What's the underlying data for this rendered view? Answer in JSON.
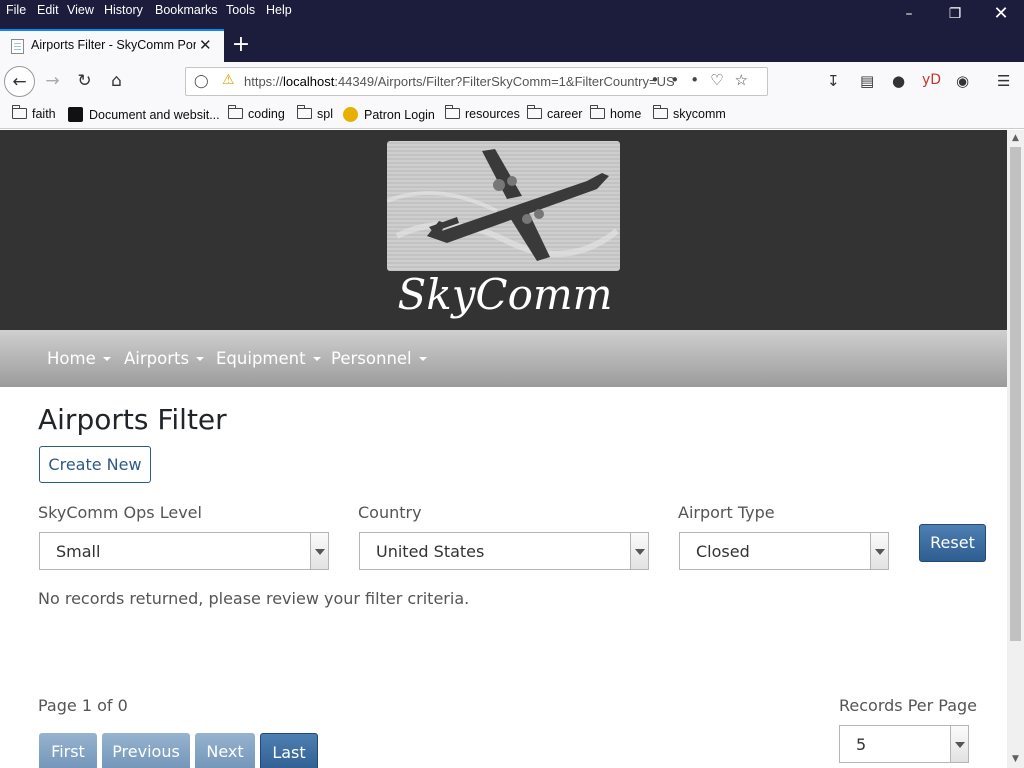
{
  "menubar": {
    "items": [
      "File",
      "Edit",
      "View",
      "History",
      "Bookmarks",
      "Tools",
      "Help"
    ]
  },
  "tab": {
    "title": "Airports Filter - SkyComm Portal"
  },
  "urlbar": {
    "url_prefix": "https://",
    "url_host": "localhost",
    "url_rest": ":44349/Airports/Filter?FilterSkyComm=1&FilterCountry=US"
  },
  "bookmarks": [
    {
      "label": "faith",
      "icon": "folder-icon"
    },
    {
      "label": "Document and websit...",
      "icon": "site-icon"
    },
    {
      "label": "coding",
      "icon": "folder-icon"
    },
    {
      "label": "spl",
      "icon": "folder-icon"
    },
    {
      "label": "Patron Login",
      "icon": "site-icon"
    },
    {
      "label": "resources",
      "icon": "folder-icon"
    },
    {
      "label": "career",
      "icon": "folder-icon"
    },
    {
      "label": "home",
      "icon": "folder-icon"
    },
    {
      "label": "skycomm",
      "icon": "folder-icon"
    }
  ],
  "site": {
    "name": "SkyComm",
    "nav": [
      "Home",
      "Airports",
      "Equipment",
      "Personnel"
    ]
  },
  "main": {
    "title": "Airports Filter",
    "create_label": "Create New",
    "filters": {
      "ops_level": {
        "label": "SkyComm Ops Level",
        "value": "Small"
      },
      "country": {
        "label": "Country",
        "value": "United States"
      },
      "airport_type": {
        "label": "Airport Type",
        "value": "Closed"
      }
    },
    "reset_label": "Reset",
    "empty_message": "No records returned, please review your filter criteria.",
    "pagination": {
      "info": "Page 1 of 0",
      "first": "First",
      "previous": "Previous",
      "next": "Next",
      "last": "Last",
      "records_per_page_label": "Records Per Page",
      "records_per_page_value": "5"
    }
  },
  "colors": {
    "header_bg": "#333333",
    "primary": "#2e5a86",
    "text": "#555555"
  }
}
